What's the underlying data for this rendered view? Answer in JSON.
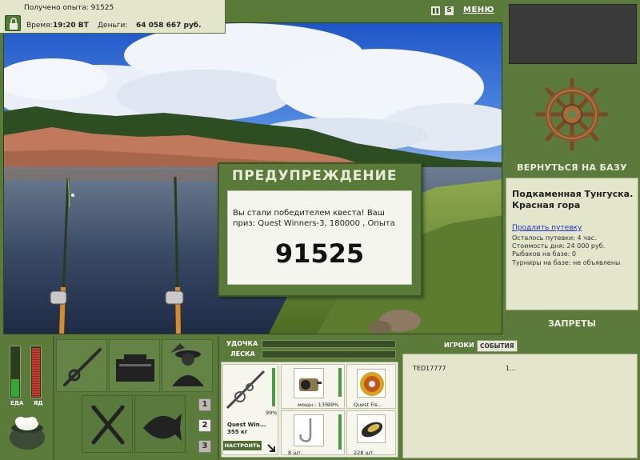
{
  "header": {
    "experience_label": "Получено опыта:",
    "experience_value": "91525",
    "time_label": "Время:",
    "time_value": "19:20 ВТ",
    "money_label": "Деньги:",
    "money_value": "64 058 667 руб."
  },
  "top_controls": {
    "pause_icon": "pause-icon",
    "sound_label": "S",
    "menu_label": "МЕНЮ"
  },
  "right_panel": {
    "return_label": "ВЕРНУТЬСЯ НА БАЗУ",
    "base_name": "Подкаменная Тунгуска. Красная гора",
    "extend_link": "Продлить путевку",
    "remaining": "Осталось путевки: 4 час.",
    "day_cost": "Стоимость дня: 24 000 руб.",
    "fishers": "Рыбаков на базе: 0",
    "tournaments": "Турниры на базе: не объявлены",
    "bans_label": "ЗАПРЕТЫ"
  },
  "dialog": {
    "title": "ПРЕДУПРЕЖДЕНИЕ",
    "message": "Вы стали победителем квеста! Ваш приз: Quest Winners-3, 180000 , Опыта",
    "number": "91525"
  },
  "bottom": {
    "food_label": "ЕДА",
    "poison_label": "ЯД",
    "food_level": 0.35,
    "poison_level": 0.95,
    "page_buttons": [
      "1",
      "2",
      "3"
    ],
    "active_page": "2",
    "rod_label": "УДОЧКА",
    "line_label": "ЛЕСКА",
    "rod_name": "Quest Win...",
    "rod_weight": "355 кг",
    "rod_percent": "99%",
    "configure_label": "НАСТРОИТЬ",
    "reel_text": "мощн.: 135",
    "reel_percent": "99%",
    "line_name": "Quest Fis...",
    "hook_count": "8 шт.",
    "bait_count": "228 шт.",
    "players_tab": "ИГРОКИ",
    "events_tab": "СОБЫТИЯ",
    "event_player": "TED17777",
    "event_text": "1..."
  },
  "colors": {
    "panel_green": "#5a7a3a",
    "panel_light": "#e4e6cc",
    "meter_green": "#39a63a",
    "meter_red": "#c63a32"
  }
}
